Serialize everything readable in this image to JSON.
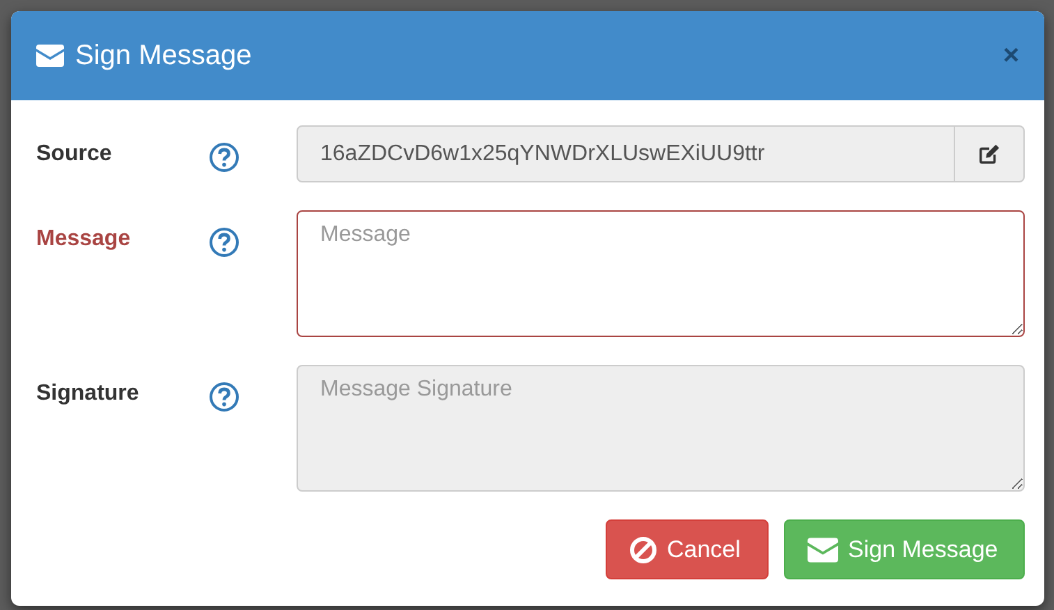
{
  "dialog": {
    "title": "Sign Message",
    "close": "×"
  },
  "fields": [
    {
      "label": "Source",
      "kind": "input",
      "value": "16aZDCvD6w1x25qYNWDrXLUswEXiUU9ttr",
      "disabled": true,
      "error": false,
      "addon": true
    },
    {
      "label": "Message",
      "kind": "textarea",
      "placeholder": "Message",
      "disabled": false,
      "error": true
    },
    {
      "label": "Signature",
      "kind": "textarea",
      "placeholder": "Message Signature",
      "disabled": true,
      "error": false
    }
  ],
  "buttons": [
    {
      "label": "Cancel",
      "kind": "cancel"
    },
    {
      "label": "Sign Message",
      "kind": "sign"
    }
  ]
}
